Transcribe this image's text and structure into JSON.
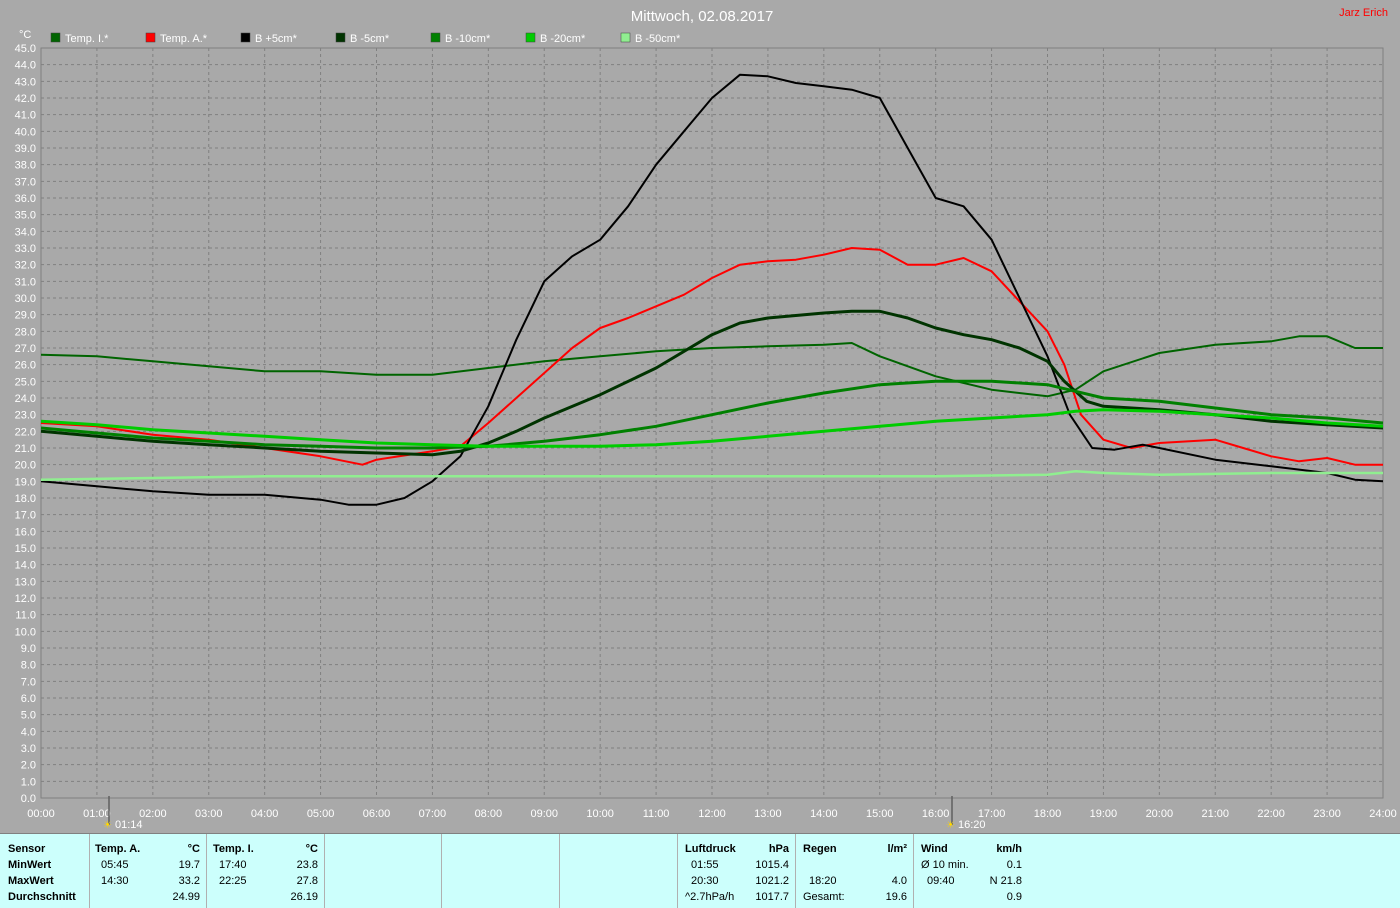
{
  "title": "Mittwoch, 02.08.2017",
  "author": "Jarz Erich",
  "y_unit": "°C",
  "sunrise_label": "01:14",
  "sunset_label": "16:20",
  "colors": {
    "background": "#a9a9a9",
    "grid": "#808080"
  },
  "chart_data": {
    "type": "line",
    "title": "Mittwoch, 02.08.2017",
    "ylabel": "°C",
    "ylim": [
      0,
      45
    ],
    "xlim": [
      0,
      24
    ],
    "x_ticks": [
      "00:00",
      "01:00",
      "02:00",
      "03:00",
      "04:00",
      "05:00",
      "06:00",
      "07:00",
      "08:00",
      "09:00",
      "10:00",
      "11:00",
      "12:00",
      "13:00",
      "14:00",
      "15:00",
      "16:00",
      "17:00",
      "18:00",
      "19:00",
      "20:00",
      "21:00",
      "22:00",
      "23:00",
      "24:00"
    ],
    "y_ticks": [
      "0.0",
      "1.0",
      "2.0",
      "3.0",
      "4.0",
      "5.0",
      "6.0",
      "7.0",
      "8.0",
      "9.0",
      "10.0",
      "11.0",
      "12.0",
      "13.0",
      "14.0",
      "15.0",
      "16.0",
      "17.0",
      "18.0",
      "19.0",
      "20.0",
      "21.0",
      "22.0",
      "23.0",
      "24.0",
      "25.0",
      "26.0",
      "27.0",
      "28.0",
      "29.0",
      "30.0",
      "31.0",
      "32.0",
      "33.0",
      "34.0",
      "35.0",
      "36.0",
      "37.0",
      "38.0",
      "39.0",
      "40.0",
      "41.0",
      "42.0",
      "43.0",
      "44.0",
      "45.0"
    ],
    "grid": true,
    "legend_position": "top",
    "series": [
      {
        "name": "Temp. I.*",
        "color": "#006400",
        "points": [
          [
            0,
            26.6
          ],
          [
            1,
            26.5
          ],
          [
            2,
            26.2
          ],
          [
            3,
            25.9
          ],
          [
            4,
            25.6
          ],
          [
            5,
            25.6
          ],
          [
            6,
            25.4
          ],
          [
            7,
            25.4
          ],
          [
            8,
            25.8
          ],
          [
            9,
            26.2
          ],
          [
            10,
            26.5
          ],
          [
            11,
            26.8
          ],
          [
            12,
            27.0
          ],
          [
            13,
            27.1
          ],
          [
            14,
            27.2
          ],
          [
            14.5,
            27.3
          ],
          [
            15,
            26.5
          ],
          [
            16,
            25.3
          ],
          [
            17,
            24.5
          ],
          [
            18,
            24.1
          ],
          [
            18.5,
            24.5
          ],
          [
            19,
            25.6
          ],
          [
            20,
            26.7
          ],
          [
            21,
            27.2
          ],
          [
            22,
            27.4
          ],
          [
            22.5,
            27.7
          ],
          [
            23,
            27.7
          ],
          [
            23.5,
            27.0
          ],
          [
            24,
            27.0
          ]
        ]
      },
      {
        "name": "Temp. A.*",
        "color": "#ff0000",
        "points": [
          [
            0,
            22.5
          ],
          [
            1,
            22.3
          ],
          [
            2,
            21.8
          ],
          [
            3,
            21.5
          ],
          [
            4,
            21.0
          ],
          [
            5,
            20.5
          ],
          [
            5.75,
            20.0
          ],
          [
            6,
            20.3
          ],
          [
            7,
            20.8
          ],
          [
            7.5,
            21.1
          ],
          [
            8,
            22.5
          ],
          [
            8.5,
            24.0
          ],
          [
            9,
            25.5
          ],
          [
            9.5,
            27.0
          ],
          [
            10,
            28.2
          ],
          [
            10.5,
            28.8
          ],
          [
            11,
            29.5
          ],
          [
            11.5,
            30.2
          ],
          [
            12,
            31.2
          ],
          [
            12.5,
            32.0
          ],
          [
            13,
            32.2
          ],
          [
            13.5,
            32.3
          ],
          [
            14,
            32.6
          ],
          [
            14.5,
            33.0
          ],
          [
            15,
            32.9
          ],
          [
            15.5,
            32.0
          ],
          [
            16,
            32.0
          ],
          [
            16.5,
            32.4
          ],
          [
            17,
            31.6
          ],
          [
            17.5,
            29.8
          ],
          [
            18,
            28.0
          ],
          [
            18.3,
            26.0
          ],
          [
            18.6,
            23.0
          ],
          [
            19,
            21.5
          ],
          [
            19.5,
            21.0
          ],
          [
            20,
            21.3
          ],
          [
            21,
            21.5
          ],
          [
            21.5,
            21.0
          ],
          [
            22,
            20.5
          ],
          [
            22.5,
            20.2
          ],
          [
            23,
            20.4
          ],
          [
            23.5,
            20.0
          ],
          [
            24,
            20.0
          ]
        ]
      },
      {
        "name": "B +5cm*",
        "color": "#000000",
        "points": [
          [
            0,
            19.0
          ],
          [
            1,
            18.7
          ],
          [
            2,
            18.4
          ],
          [
            3,
            18.2
          ],
          [
            4,
            18.2
          ],
          [
            5,
            17.9
          ],
          [
            5.5,
            17.6
          ],
          [
            6,
            17.6
          ],
          [
            6.5,
            18.0
          ],
          [
            7,
            19.0
          ],
          [
            7.5,
            20.5
          ],
          [
            8,
            23.5
          ],
          [
            8.5,
            27.5
          ],
          [
            9,
            31.0
          ],
          [
            9.5,
            32.5
          ],
          [
            10,
            33.5
          ],
          [
            10.5,
            35.5
          ],
          [
            11,
            38.0
          ],
          [
            11.5,
            40.0
          ],
          [
            12,
            42.0
          ],
          [
            12.5,
            43.4
          ],
          [
            13,
            43.3
          ],
          [
            13.5,
            42.9
          ],
          [
            14,
            42.7
          ],
          [
            14.5,
            42.5
          ],
          [
            15,
            42.0
          ],
          [
            15.5,
            39.0
          ],
          [
            16,
            36.0
          ],
          [
            16.5,
            35.5
          ],
          [
            17,
            33.5
          ],
          [
            17.5,
            30.0
          ],
          [
            18,
            26.5
          ],
          [
            18.4,
            23.0
          ],
          [
            18.8,
            21.0
          ],
          [
            19.2,
            20.9
          ],
          [
            19.7,
            21.2
          ],
          [
            20,
            21.0
          ],
          [
            21,
            20.3
          ],
          [
            22,
            19.9
          ],
          [
            23,
            19.5
          ],
          [
            23.5,
            19.1
          ],
          [
            24,
            19.0
          ]
        ]
      },
      {
        "name": "B -5cm*",
        "color": "#003300",
        "points": [
          [
            0,
            22.0
          ],
          [
            1,
            21.7
          ],
          [
            2,
            21.4
          ],
          [
            3,
            21.2
          ],
          [
            4,
            21.0
          ],
          [
            5,
            20.8
          ],
          [
            6,
            20.7
          ],
          [
            7,
            20.6
          ],
          [
            7.5,
            20.8
          ],
          [
            8,
            21.3
          ],
          [
            8.5,
            22.0
          ],
          [
            9,
            22.8
          ],
          [
            10,
            24.2
          ],
          [
            11,
            25.8
          ],
          [
            12,
            27.8
          ],
          [
            12.5,
            28.5
          ],
          [
            13,
            28.8
          ],
          [
            14,
            29.1
          ],
          [
            14.5,
            29.2
          ],
          [
            15,
            29.2
          ],
          [
            15.5,
            28.8
          ],
          [
            16,
            28.2
          ],
          [
            16.5,
            27.8
          ],
          [
            17,
            27.5
          ],
          [
            17.5,
            27.0
          ],
          [
            18,
            26.2
          ],
          [
            18.3,
            25.0
          ],
          [
            18.7,
            23.8
          ],
          [
            19,
            23.5
          ],
          [
            20,
            23.3
          ],
          [
            21,
            23.0
          ],
          [
            22,
            22.6
          ],
          [
            23,
            22.4
          ],
          [
            24,
            22.2
          ]
        ]
      },
      {
        "name": "B -10cm*",
        "color": "#008000",
        "points": [
          [
            0,
            22.2
          ],
          [
            1,
            21.9
          ],
          [
            2,
            21.6
          ],
          [
            3,
            21.4
          ],
          [
            4,
            21.2
          ],
          [
            5,
            21.1
          ],
          [
            6,
            21.0
          ],
          [
            7,
            21.0
          ],
          [
            8,
            21.1
          ],
          [
            9,
            21.4
          ],
          [
            10,
            21.8
          ],
          [
            11,
            22.3
          ],
          [
            12,
            23.0
          ],
          [
            13,
            23.7
          ],
          [
            14,
            24.3
          ],
          [
            15,
            24.8
          ],
          [
            16,
            25.0
          ],
          [
            17,
            25.0
          ],
          [
            18,
            24.8
          ],
          [
            18.5,
            24.4
          ],
          [
            19,
            24.0
          ],
          [
            20,
            23.8
          ],
          [
            21,
            23.4
          ],
          [
            22,
            23.0
          ],
          [
            23,
            22.8
          ],
          [
            24,
            22.5
          ]
        ]
      },
      {
        "name": "B -20cm*",
        "color": "#00cc00",
        "points": [
          [
            0,
            22.6
          ],
          [
            1,
            22.4
          ],
          [
            2,
            22.1
          ],
          [
            3,
            21.9
          ],
          [
            4,
            21.7
          ],
          [
            5,
            21.5
          ],
          [
            6,
            21.3
          ],
          [
            7,
            21.2
          ],
          [
            8,
            21.1
          ],
          [
            9,
            21.1
          ],
          [
            10,
            21.1
          ],
          [
            11,
            21.2
          ],
          [
            12,
            21.4
          ],
          [
            13,
            21.7
          ],
          [
            14,
            22.0
          ],
          [
            15,
            22.3
          ],
          [
            16,
            22.6
          ],
          [
            17,
            22.8
          ],
          [
            18,
            23.0
          ],
          [
            18.5,
            23.2
          ],
          [
            19,
            23.3
          ],
          [
            20,
            23.2
          ],
          [
            21,
            23.0
          ],
          [
            22,
            22.8
          ],
          [
            23,
            22.5
          ],
          [
            24,
            22.3
          ]
        ]
      },
      {
        "name": "B -50cm*",
        "color": "#90ee90",
        "points": [
          [
            0,
            19.1
          ],
          [
            2,
            19.2
          ],
          [
            4,
            19.3
          ],
          [
            6,
            19.3
          ],
          [
            8,
            19.3
          ],
          [
            10,
            19.3
          ],
          [
            12,
            19.3
          ],
          [
            14,
            19.3
          ],
          [
            16,
            19.3
          ],
          [
            18,
            19.4
          ],
          [
            18.5,
            19.6
          ],
          [
            19,
            19.5
          ],
          [
            20,
            19.4
          ],
          [
            22,
            19.5
          ],
          [
            24,
            19.5
          ]
        ]
      }
    ]
  },
  "stats": {
    "sensor": {
      "header": "Sensor",
      "min": "MinWert",
      "max": "MaxWert",
      "avg": "Durchschnitt"
    },
    "temp_a": {
      "header": "Temp. A.",
      "unit": "°C",
      "min_time": "05:45",
      "min_val": "19.7",
      "max_time": "14:30",
      "max_val": "33.2",
      "avg": "24.99"
    },
    "temp_i": {
      "header": "Temp. I.",
      "unit": "°C",
      "min_time": "17:40",
      "min_val": "23.8",
      "max_time": "22:25",
      "max_val": "27.8",
      "avg": "26.19"
    },
    "pressure": {
      "header": "Luftdruck",
      "unit": "hPa",
      "min_time": "01:55",
      "min_val": "1015.4",
      "max_time": "20:30",
      "max_val": "1021.2",
      "trend": "^2.7hPa/h",
      "avg": "1017.7"
    },
    "rain": {
      "header": "Regen",
      "unit": "l/m²",
      "time": "18:20",
      "val": "4.0",
      "total_label": "Gesamt:",
      "total": "19.6"
    },
    "wind": {
      "header": "Wind",
      "unit": "km/h",
      "avg_label": "Ø 10 min.",
      "avg": "0.1",
      "max_time": "09:40",
      "max_val": "N 21.8",
      "day_avg": "0.9"
    }
  }
}
